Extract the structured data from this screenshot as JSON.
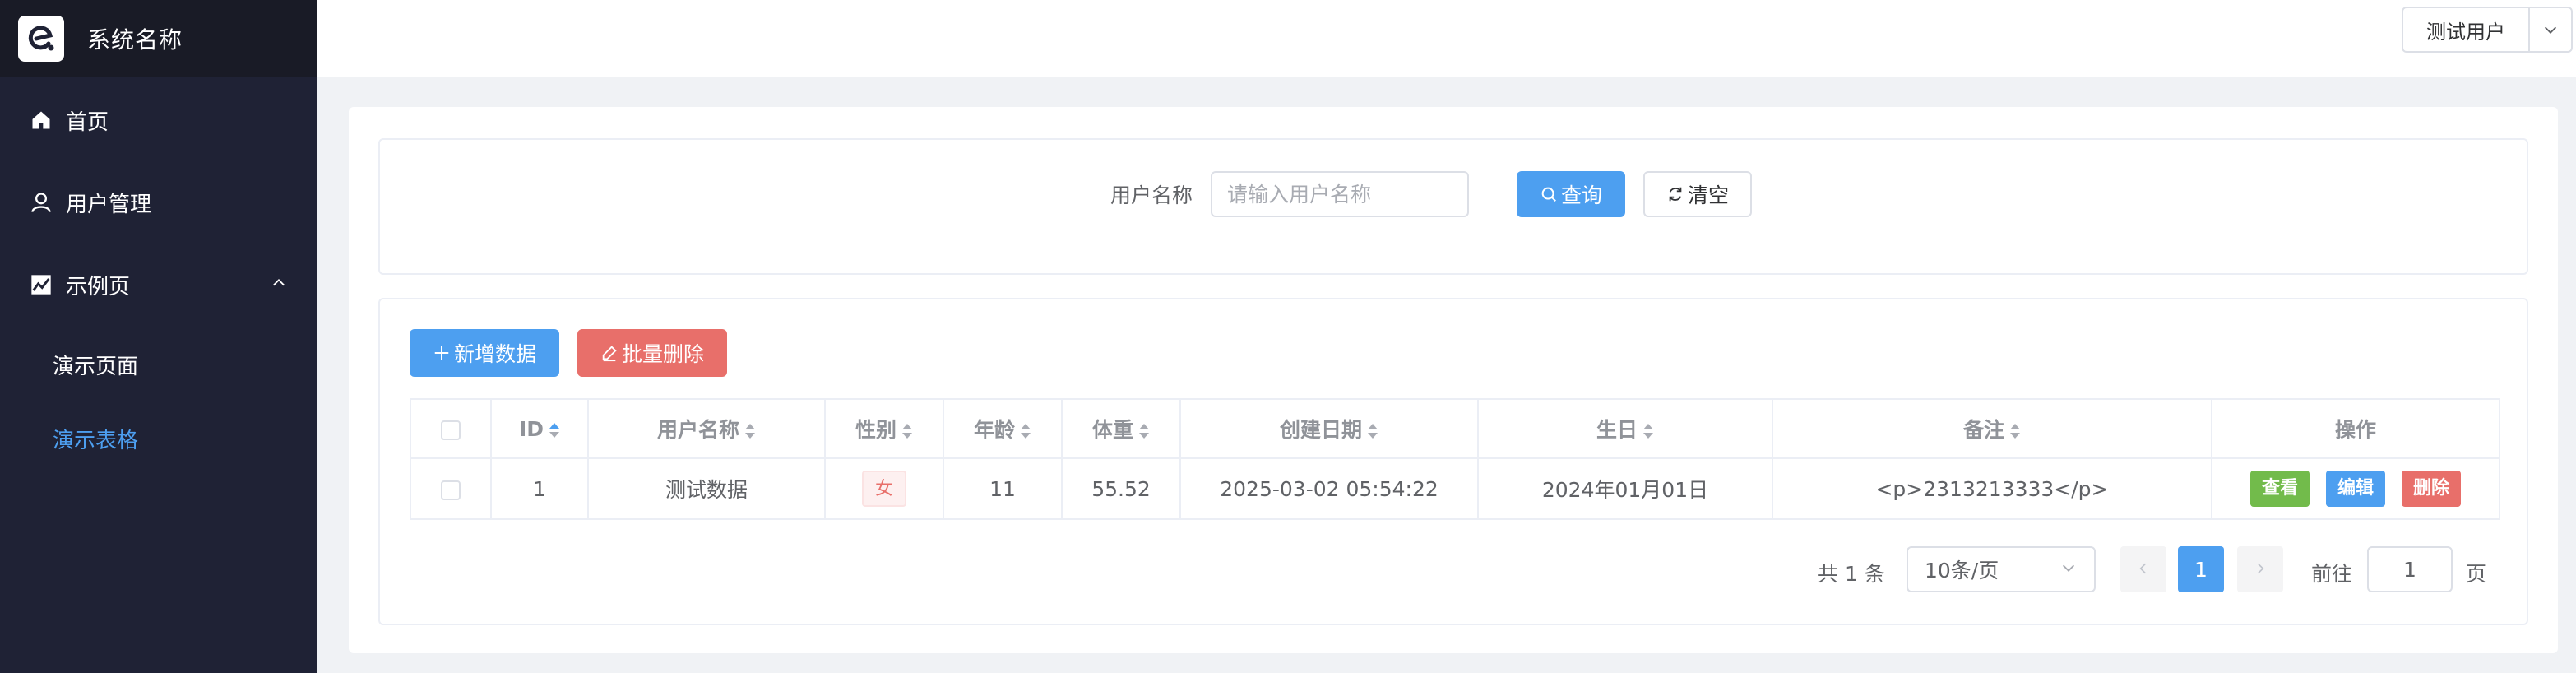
{
  "app": {
    "title": "系统名称",
    "logo_icon": "logo-e-icon"
  },
  "sidebar": {
    "items": [
      {
        "label": "首页",
        "icon": "home-icon"
      },
      {
        "label": "用户管理",
        "icon": "user-icon"
      },
      {
        "label": "示例页",
        "icon": "chart-icon",
        "expanded": true,
        "children": [
          {
            "label": "演示页面",
            "active": false
          },
          {
            "label": "演示表格",
            "active": true
          }
        ]
      }
    ]
  },
  "header": {
    "user": "测试用户"
  },
  "search": {
    "label": "用户名称",
    "placeholder": "请输入用户名称",
    "value": "",
    "query_button": "查询",
    "clear_button": "清空"
  },
  "toolbar": {
    "add_button": "新增数据",
    "batch_delete_button": "批量删除"
  },
  "table": {
    "columns": [
      "ID",
      "用户名称",
      "性别",
      "年龄",
      "体重",
      "创建日期",
      "生日",
      "备注",
      "操作"
    ],
    "sort_active_column": "ID",
    "rows": [
      {
        "id": "1",
        "name": "测试数据",
        "gender": "女",
        "age": "11",
        "weight": "55.52",
        "created": "2025-03-02 05:54:22",
        "birthday": "2024年01月01日",
        "remark": "<p>2313213333</p>",
        "actions": {
          "view": "查看",
          "edit": "编辑",
          "delete": "删除"
        }
      }
    ]
  },
  "pagination": {
    "total": "共 1 条",
    "page_size": "10条/页",
    "current_page": "1",
    "goto_label": "前往",
    "goto_value": "1",
    "page_suffix": "页"
  },
  "colors": {
    "sidebar_bg": "#1f2235",
    "logo_bar_bg": "#191b26",
    "primary": "#4d9ff0",
    "danger": "#e86f6a",
    "success": "#72bb4b",
    "page_bg": "#f0f2f5"
  }
}
